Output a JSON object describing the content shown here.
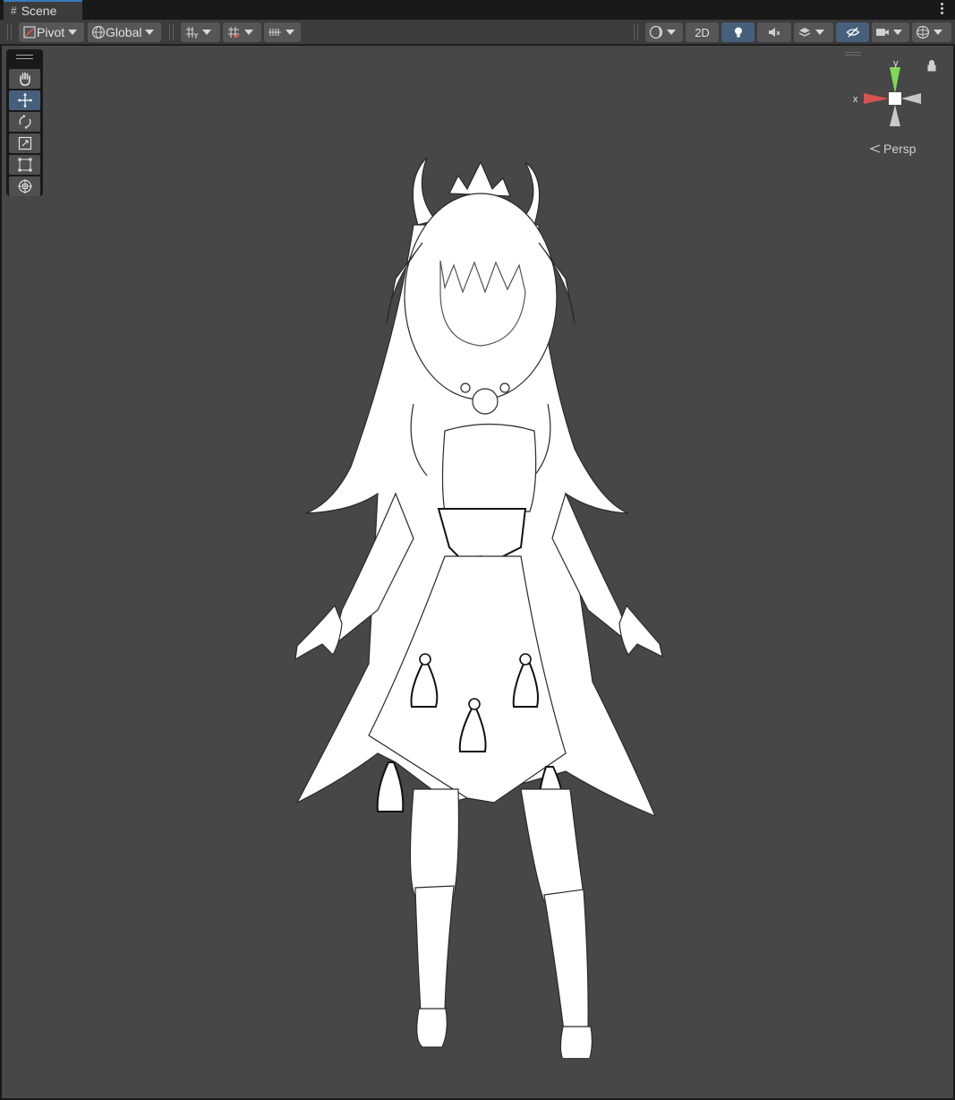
{
  "window": {
    "tab_label": "Scene"
  },
  "toolbar": {
    "pivot_label": "Pivot",
    "global_label": "Global",
    "mode_2d_label": "2D"
  },
  "tools": [
    {
      "name": "hand-tool"
    },
    {
      "name": "move-tool",
      "selected": true
    },
    {
      "name": "rotate-tool"
    },
    {
      "name": "scale-tool"
    },
    {
      "name": "rect-tool"
    },
    {
      "name": "transform-tool"
    }
  ],
  "gizmo": {
    "y_label": "y",
    "x_label": "x",
    "projection_label": "Persp"
  },
  "colors": {
    "viewport_bg": "#474747",
    "toolbar_bg": "#3c3c3c",
    "active_button": "#46607c",
    "axis_x": "#d9534f",
    "axis_y": "#7ed957",
    "axis_z": "#c8c8c8"
  }
}
